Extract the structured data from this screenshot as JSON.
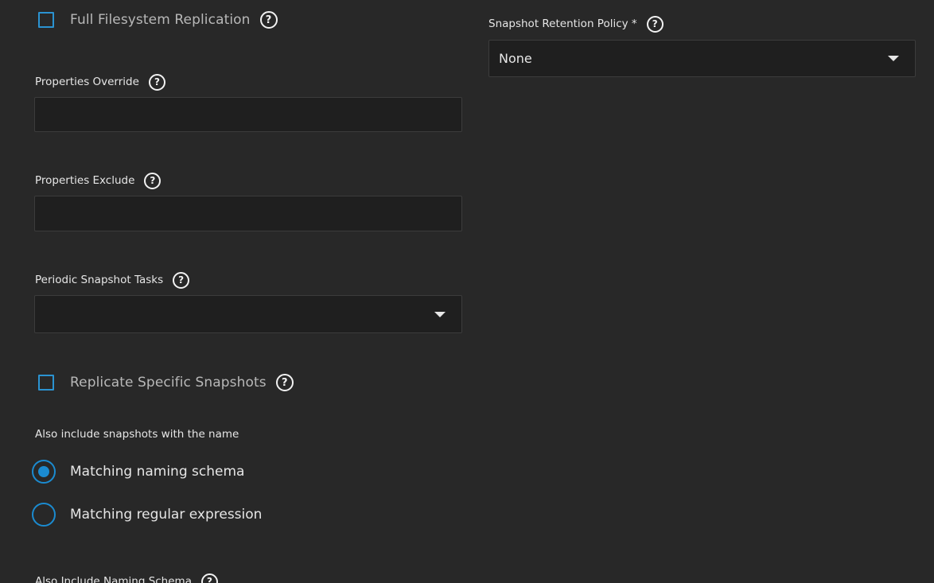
{
  "full_filesystem_replication": {
    "label": "Full Filesystem Replication",
    "checked": false,
    "help_icon": "help-circle-icon"
  },
  "snapshot_retention_policy": {
    "label": "Snapshot Retention Policy *",
    "value": "None",
    "help_icon": "help-circle-icon"
  },
  "properties_override": {
    "label": "Properties Override",
    "value": "",
    "help_icon": "help-circle-icon"
  },
  "properties_exclude": {
    "label": "Properties Exclude",
    "value": "",
    "help_icon": "help-circle-icon"
  },
  "periodic_snapshot_tasks": {
    "label": "Periodic Snapshot Tasks",
    "value": "",
    "help_icon": "help-circle-icon"
  },
  "replicate_specific_snapshots": {
    "label": "Replicate Specific Snapshots",
    "checked": false,
    "help_icon": "help-circle-icon"
  },
  "also_include": {
    "heading": "Also include snapshots with the name",
    "options": [
      {
        "label": "Matching naming schema",
        "selected": true
      },
      {
        "label": "Matching regular expression",
        "selected": false
      }
    ]
  },
  "also_include_naming_schema": {
    "label": "Also Include Naming Schema",
    "help_icon": "help-circle-icon"
  },
  "colors": {
    "background": "#282828",
    "input_background": "#1f1f1f",
    "accent": "#1b8bd0"
  }
}
